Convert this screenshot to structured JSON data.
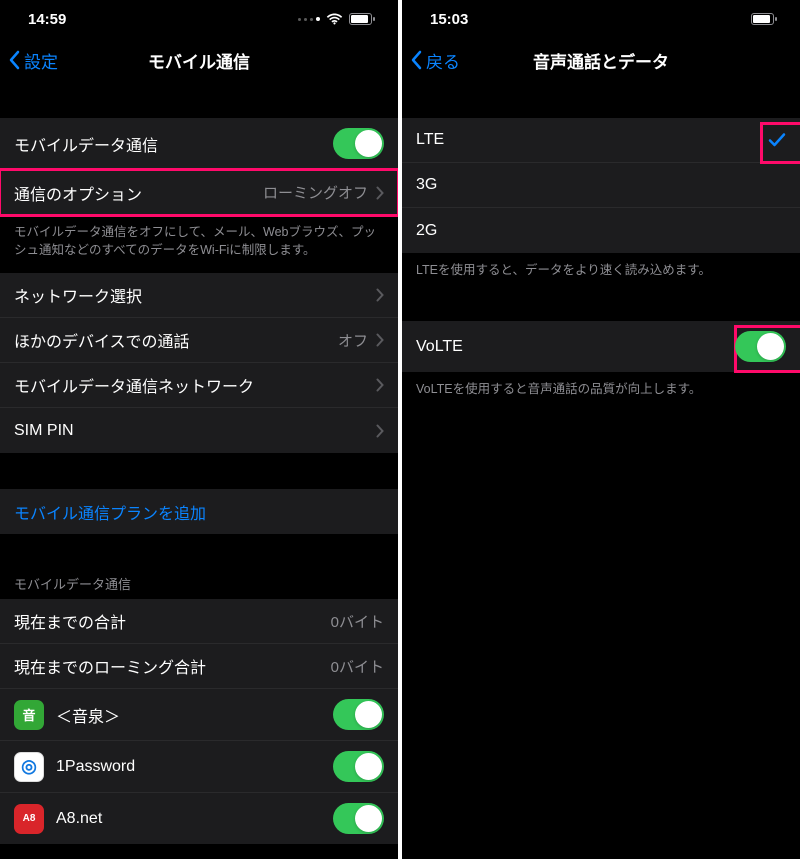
{
  "left": {
    "time": "14:59",
    "back_label": "設定",
    "title": "モバイル通信",
    "rows": {
      "mobile_data": "モバイルデータ通信",
      "options": "通信のオプション",
      "options_value": "ローミングオフ",
      "options_note": "モバイルデータ通信をオフにして、メール、Webブラウズ、プッシュ通知などのすべてのデータをWi-Fiに制限します。",
      "network_select": "ネットワーク選択",
      "other_device": "ほかのデバイスでの通話",
      "other_device_value": "オフ",
      "data_network": "モバイルデータ通信ネットワーク",
      "sim_pin": "SIM PIN",
      "add_plan": "モバイル通信プランを追加",
      "section_usage": "モバイルデータ通信",
      "total": "現在までの合計",
      "total_value": "0バイト",
      "roaming_total": "現在までのローミング合計",
      "roaming_total_value": "0バイト",
      "app1": "＜音泉＞",
      "app2": "1Password",
      "app3": "A8.net"
    }
  },
  "right": {
    "time": "15:03",
    "back_label": "戻る",
    "title": "音声通話とデータ",
    "rows": {
      "lte": "LTE",
      "g3": "3G",
      "g2": "2G",
      "lte_note": "LTEを使用すると、データをより速く読み込めます。",
      "volte": "VoLTE",
      "volte_note": "VoLTEを使用すると音声通話の品質が向上します。"
    }
  }
}
